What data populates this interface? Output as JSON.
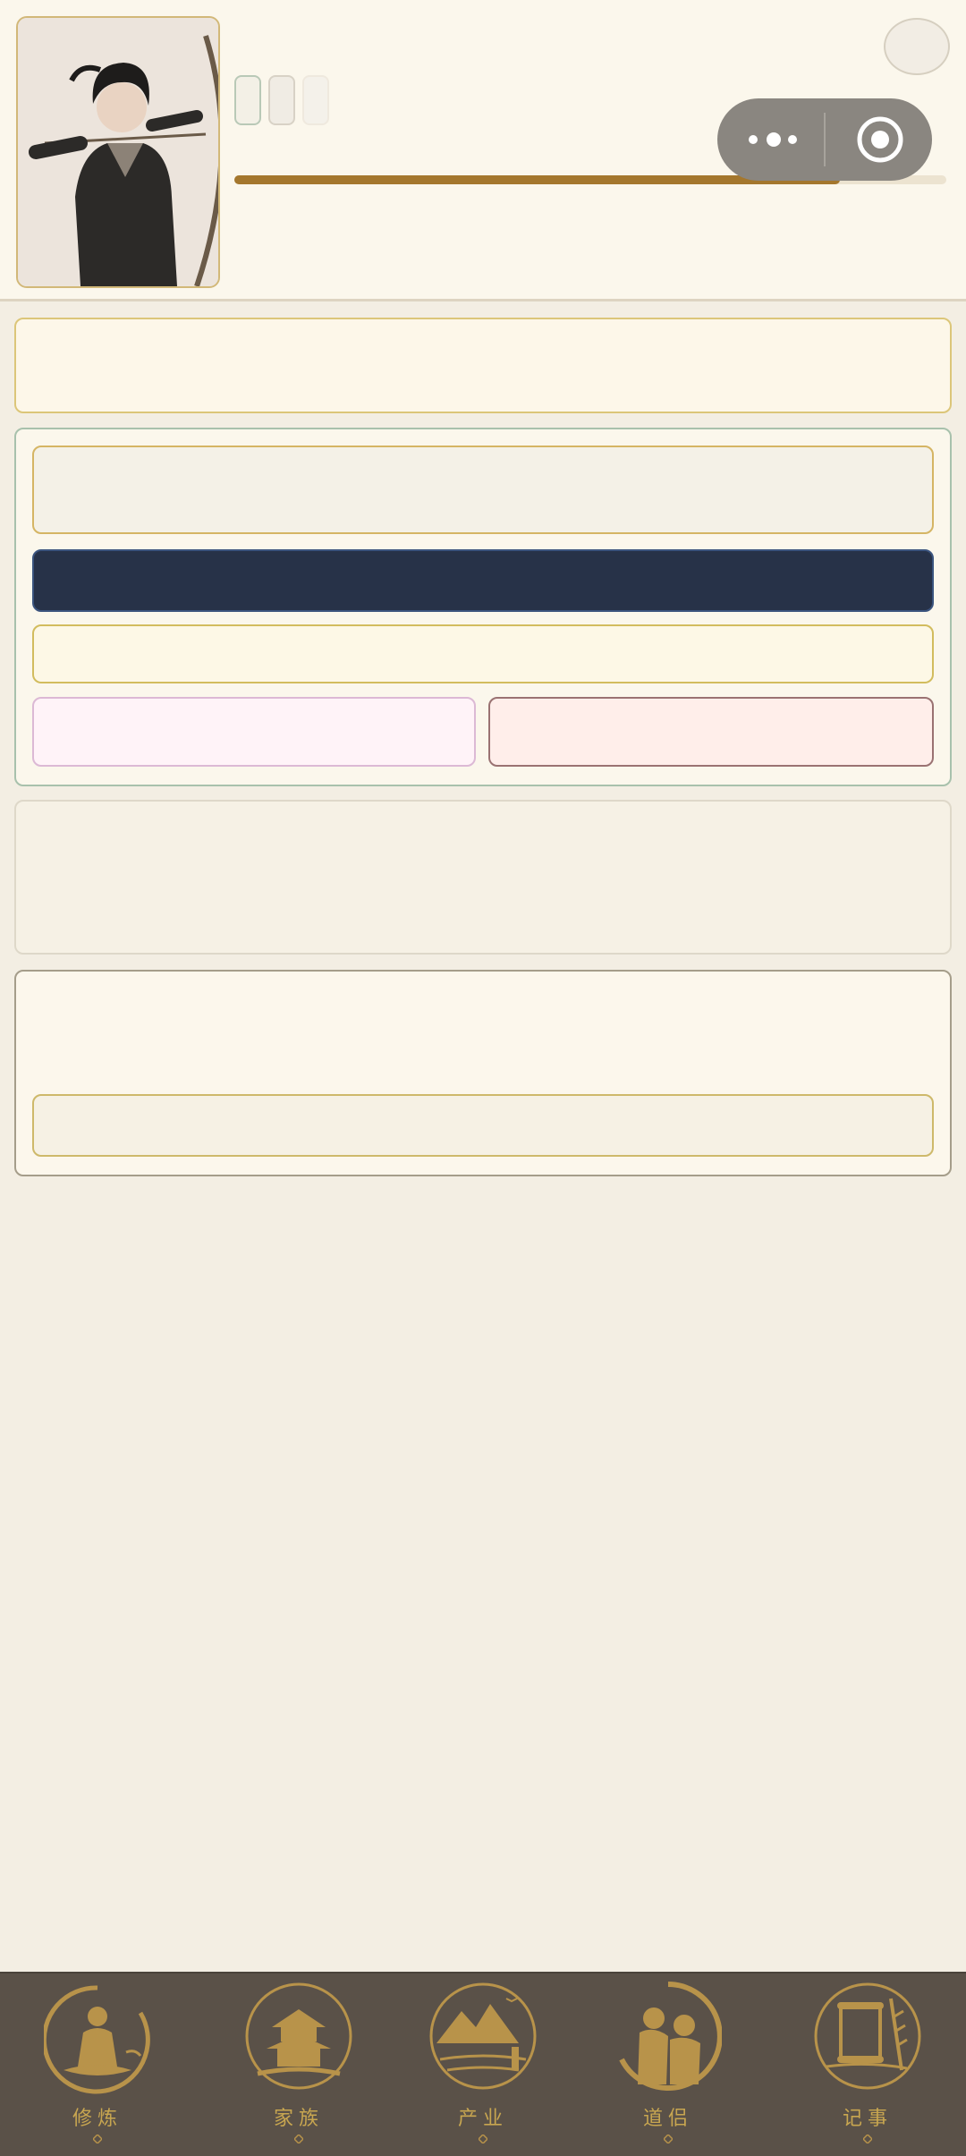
{
  "header": {
    "avatar_icon": "archer-portrait",
    "progress": 0.85,
    "menu_icon": "more-dots-icon",
    "capsule_close_icon": "target-icon"
  },
  "tabbar": {
    "tabs": [
      {
        "label": "修炼",
        "icon": "meditation-emblem-icon"
      },
      {
        "label": "家族",
        "icon": "pavilion-emblem-icon"
      },
      {
        "label": "产业",
        "icon": "landscape-emblem-icon"
      },
      {
        "label": "道侣",
        "icon": "couple-emblem-icon"
      },
      {
        "label": "记事",
        "icon": "scroll-emblem-icon"
      }
    ]
  },
  "colors": {
    "accent_gold": "#c8a650",
    "primary_navy": "#273248",
    "progress": "#a4772d",
    "tabbar_bg": "#5a5148"
  }
}
